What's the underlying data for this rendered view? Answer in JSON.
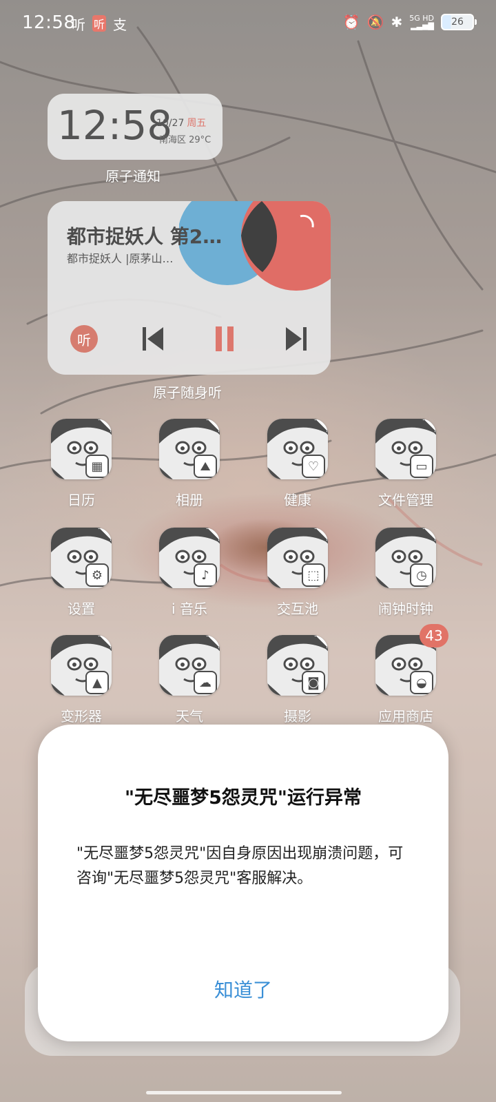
{
  "status_bar": {
    "time": "12:58",
    "app_icons": [
      "听",
      "听",
      "支"
    ],
    "network": "5G HD",
    "battery": "26"
  },
  "clock_widget": {
    "time": "12:58",
    "date": "10/27",
    "weekday": "周五",
    "location_weather": "南海区 29°C",
    "caption": "原子通知"
  },
  "music_widget": {
    "title": "都市捉妖人 第2…",
    "subtitle": "都市捉妖人 |原茅山…",
    "app_badge": "听",
    "caption": "原子随身听",
    "accent_color": "#d24a3c"
  },
  "apps": [
    {
      "label": "日历",
      "icon": "calendar-icon"
    },
    {
      "label": "相册",
      "icon": "gallery-icon"
    },
    {
      "label": "健康",
      "icon": "heart-icon"
    },
    {
      "label": "文件管理",
      "icon": "folder-icon"
    },
    {
      "label": "设置",
      "icon": "gear-icon"
    },
    {
      "label": "i 音乐",
      "icon": "music-note-icon"
    },
    {
      "label": "交互池",
      "icon": "cube-icon"
    },
    {
      "label": "闹钟时钟",
      "icon": "clock-icon"
    },
    {
      "label": "变形器",
      "icon": "shapes-icon"
    },
    {
      "label": "天气",
      "icon": "cloud-icon"
    },
    {
      "label": "摄影",
      "icon": "camera-icon"
    },
    {
      "label": "应用商店",
      "icon": "store-icon",
      "badge": "43"
    }
  ],
  "dialog": {
    "title": "\"无尽噩梦5怨灵咒\"运行异常",
    "body": "\"无尽噩梦5怨灵咒\"因自身原因出现崩溃问题，可咨询\"无尽噩梦5怨灵咒\"客服解决。",
    "button": "知道了",
    "button_color": "#3a8fd6"
  }
}
